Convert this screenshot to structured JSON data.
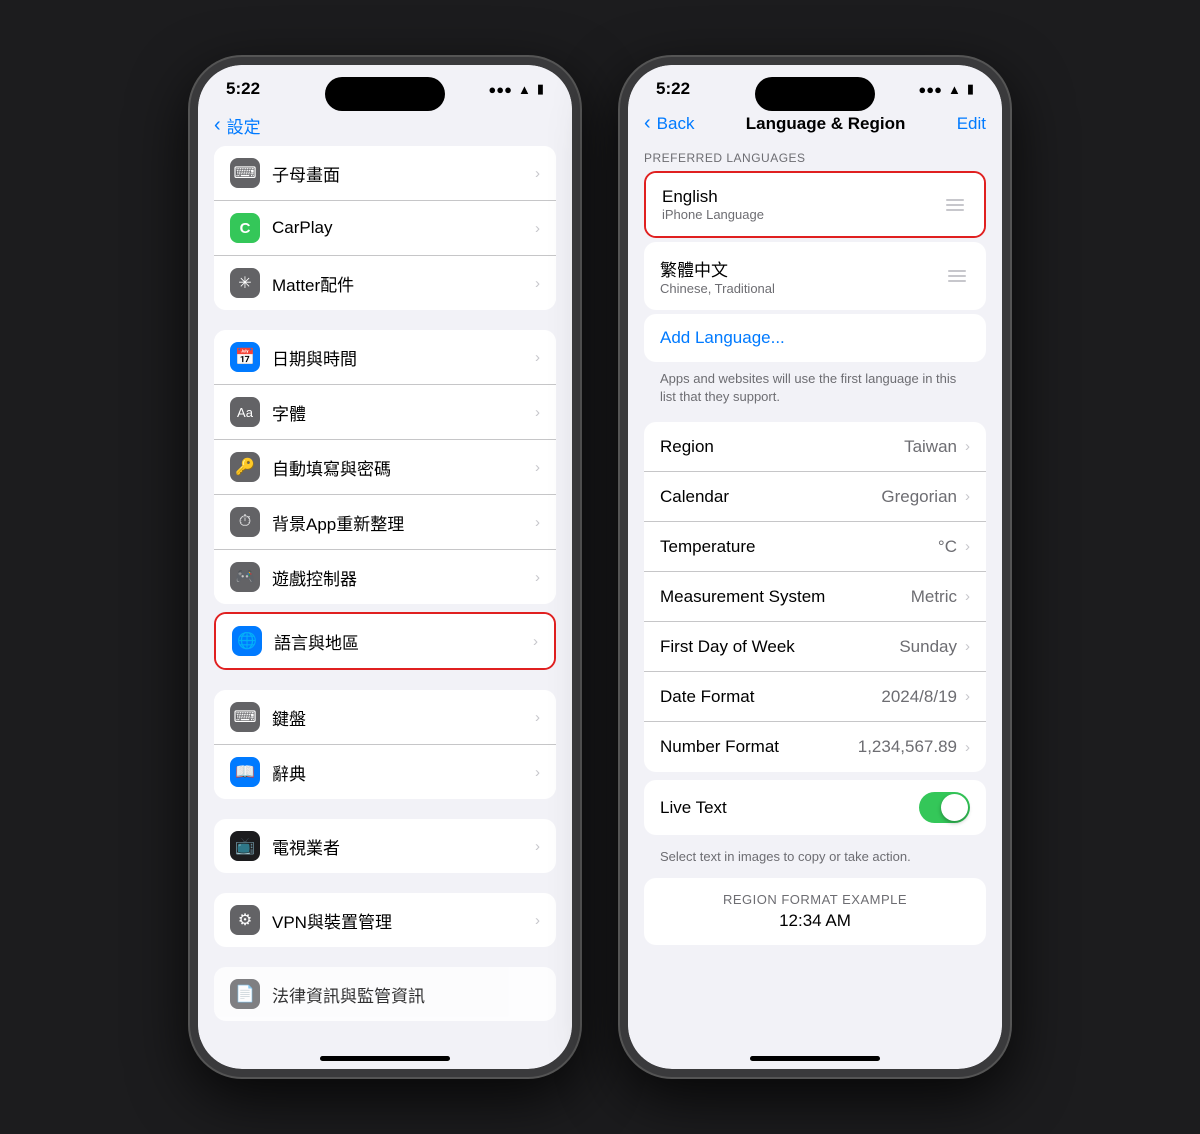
{
  "phone_left": {
    "status": {
      "time": "5:22",
      "signal": "...",
      "wifi": "WiFi",
      "battery": "🔋"
    },
    "nav": {
      "back_label": "設定"
    },
    "sections": [
      {
        "items": [
          {
            "icon_bg": "#636366",
            "icon": "⬛",
            "icon_type": "keyboard",
            "label": "子母畫面",
            "value": ""
          },
          {
            "icon_bg": "#636366",
            "icon": "C",
            "icon_bg2": "#34c759",
            "label": "CarPlay",
            "value": ""
          },
          {
            "icon_bg": "#636366",
            "icon": "✳",
            "label": "Matter配件",
            "value": ""
          }
        ]
      },
      {
        "items": [
          {
            "icon_bg": "#007aff",
            "icon": "📅",
            "label": "日期與時間",
            "value": ""
          },
          {
            "icon_bg": "#636366",
            "icon": "Aa",
            "label": "字體",
            "value": ""
          },
          {
            "icon_bg": "#636366",
            "icon": "🔑",
            "label": "自動填寫與密碼",
            "value": ""
          },
          {
            "icon_bg": "#636366",
            "icon": "⏱",
            "label": "背景App重新整理",
            "value": ""
          },
          {
            "icon_bg": "#636366",
            "icon": "🎮",
            "label": "遊戲控制器",
            "value": ""
          },
          {
            "icon_bg": "#007aff",
            "icon": "🌐",
            "label": "語言與地區",
            "value": "",
            "highlighted": true
          },
          {
            "icon_bg": "#636366",
            "icon": "⌨",
            "label": "鍵盤",
            "value": ""
          },
          {
            "icon_bg": "#007aff",
            "icon": "📖",
            "label": "辭典",
            "value": ""
          }
        ]
      },
      {
        "items": [
          {
            "icon_bg": "#1c1c1e",
            "icon": "📺",
            "label": "電視業者",
            "value": ""
          }
        ]
      },
      {
        "items": [
          {
            "icon_bg": "#636366",
            "icon": "⚙️",
            "label": "VPN與裝置管理",
            "value": ""
          }
        ]
      }
    ],
    "bottom_item": "法律資訊與監管資訊"
  },
  "phone_right": {
    "status": {
      "time": "5:22",
      "signal": "...",
      "wifi": "WiFi",
      "battery": "🔋"
    },
    "nav": {
      "back_label": "Back",
      "title": "Language & Region",
      "action_label": "Edit"
    },
    "preferred_languages_header": "PREFERRED LANGUAGES",
    "languages": [
      {
        "title": "English",
        "subtitle": "iPhone Language",
        "highlighted": true
      },
      {
        "title": "繁體中文",
        "subtitle": "Chinese, Traditional",
        "highlighted": false
      }
    ],
    "add_language": "Add Language...",
    "info_text": "Apps and websites will use the first language in this list that they support.",
    "settings_rows": [
      {
        "label": "Region",
        "value": "Taiwan"
      },
      {
        "label": "Calendar",
        "value": "Gregorian"
      },
      {
        "label": "Temperature",
        "value": "°C"
      },
      {
        "label": "Measurement System",
        "value": "Metric"
      },
      {
        "label": "First Day of Week",
        "value": "Sunday"
      },
      {
        "label": "Date Format",
        "value": "2024/8/19"
      },
      {
        "label": "Number Format",
        "value": "1,234,567.89"
      }
    ],
    "live_text": {
      "label": "Live Text",
      "enabled": true,
      "info": "Select text in images to copy or take action."
    },
    "region_format_example": {
      "title": "Region Format Example",
      "value": "12:34 AM"
    }
  }
}
